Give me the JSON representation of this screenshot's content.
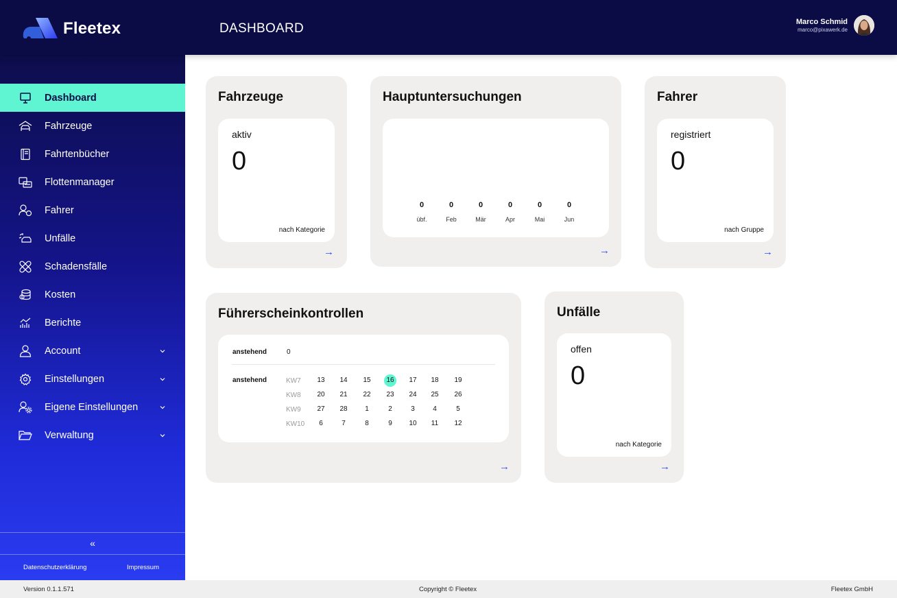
{
  "app": {
    "name": "Fleetex",
    "page_title": "DASHBOARD"
  },
  "user": {
    "name": "Marco Schmid",
    "email": "marco@pixawerk.de"
  },
  "sidebar": {
    "items": [
      {
        "label": "Dashboard",
        "icon": "monitor-icon",
        "active": true
      },
      {
        "label": "Fahrzeuge",
        "icon": "car-icon"
      },
      {
        "label": "Fahrtenbücher",
        "icon": "logbook-icon"
      },
      {
        "label": "Flottenmanager",
        "icon": "fleet-icon"
      },
      {
        "label": "Fahrer",
        "icon": "driver-icon"
      },
      {
        "label": "Unfälle",
        "icon": "accident-icon"
      },
      {
        "label": "Schadensfälle",
        "icon": "bandage-icon"
      },
      {
        "label": "Kosten",
        "icon": "coins-icon"
      },
      {
        "label": "Berichte",
        "icon": "chart-icon"
      },
      {
        "label": "Account",
        "icon": "user-icon",
        "expandable": true
      },
      {
        "label": "Einstellungen",
        "icon": "gear-icon",
        "expandable": true
      },
      {
        "label": "Eigene Einstellungen",
        "icon": "user-gear-icon",
        "expandable": true
      },
      {
        "label": "Verwaltung",
        "icon": "folder-icon",
        "expandable": true
      }
    ],
    "collapse_label": "«",
    "privacy_link": "Datenschutzerklärung",
    "imprint_link": "Impressum"
  },
  "footer": {
    "version": "Version 0.1.1.571",
    "copyright": "Copyright © Fleetex",
    "company": "Fleetex GmbH"
  },
  "cards": {
    "fahrzeuge": {
      "title": "Fahrzeuge",
      "label": "aktiv",
      "value": "0",
      "link": "nach Kategorie",
      "arrow": "→"
    },
    "hauptuntersuchungen": {
      "title": "Hauptuntersuchungen",
      "columns": [
        {
          "value": "0",
          "label": "übf."
        },
        {
          "value": "0",
          "label": "Feb"
        },
        {
          "value": "0",
          "label": "Mär"
        },
        {
          "value": "0",
          "label": "Apr"
        },
        {
          "value": "0",
          "label": "Mai"
        },
        {
          "value": "0",
          "label": "Jun"
        }
      ],
      "arrow": "→"
    },
    "fahrer": {
      "title": "Fahrer",
      "label": "registriert",
      "value": "0",
      "link": "nach Gruppe",
      "arrow": "→"
    },
    "fuehrerschein": {
      "title": "Führerscheinkontrollen",
      "pending_label": "anstehend",
      "pending_value": "0",
      "calendar_label": "anstehend",
      "weeks": [
        {
          "kw": "KW7",
          "days": [
            "13",
            "14",
            "15",
            "16",
            "17",
            "18",
            "19"
          ]
        },
        {
          "kw": "KW8",
          "days": [
            "20",
            "21",
            "22",
            "23",
            "24",
            "25",
            "26"
          ]
        },
        {
          "kw": "KW9",
          "days": [
            "27",
            "28",
            "1",
            "2",
            "3",
            "4",
            "5"
          ]
        },
        {
          "kw": "KW10",
          "days": [
            "6",
            "7",
            "8",
            "9",
            "10",
            "11",
            "12"
          ]
        }
      ],
      "today": "16",
      "arrow": "→"
    },
    "unfaelle": {
      "title": "Unfälle",
      "label": "offen",
      "value": "0",
      "link": "nach Kategorie",
      "arrow": "→"
    }
  },
  "colors": {
    "header": "#0b0b45",
    "accent": "#5ff5d2",
    "link": "#2b49f2",
    "card": "#f0efed"
  }
}
